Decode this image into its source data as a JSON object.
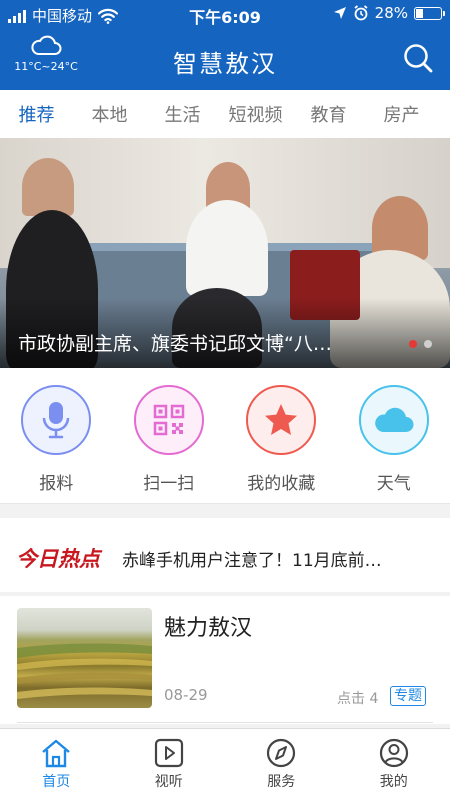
{
  "status_bar": {
    "carrier": "中国移动",
    "time": "下午6:09",
    "battery": "28%",
    "battery_level": 0.28
  },
  "header": {
    "title": "智慧敖汉",
    "weather_temp": "11°C~24°C",
    "weather_icon": "cloud-icon",
    "search_icon": "search-icon",
    "color": "#1565c0"
  },
  "tabs": [
    {
      "label": "推荐",
      "active": true
    },
    {
      "label": "本地"
    },
    {
      "label": "生活"
    },
    {
      "label": "短视频"
    },
    {
      "label": "教育"
    },
    {
      "label": "房产"
    }
  ],
  "banner": {
    "caption": "市政协副主席、旗委书记邱文博“八…",
    "slides_total": 2,
    "active_slide": 1
  },
  "shortcuts": [
    {
      "label": "报料",
      "icon": "microphone-icon",
      "color": "#7b8ff0"
    },
    {
      "label": "扫一扫",
      "icon": "qr-code-icon",
      "color": "#e46bd1"
    },
    {
      "label": "我的收藏",
      "icon": "star-icon",
      "color": "#ef5a50"
    },
    {
      "label": "天气",
      "icon": "cloud-icon",
      "color": "#48c2ea"
    }
  ],
  "hot_news": {
    "logo_text": "今日热点",
    "headline": "赤峰手机用户注意了！11月底前…"
  },
  "news": [
    {
      "title": "魅力敖汉",
      "date": "08-29",
      "clicks": "点击 4",
      "tag": "专题"
    }
  ],
  "bottom_nav": [
    {
      "label": "首页",
      "icon": "home-icon",
      "active": true
    },
    {
      "label": "视听",
      "icon": "play-icon"
    },
    {
      "label": "服务",
      "icon": "compass-icon"
    },
    {
      "label": "我的",
      "icon": "user-icon"
    }
  ]
}
